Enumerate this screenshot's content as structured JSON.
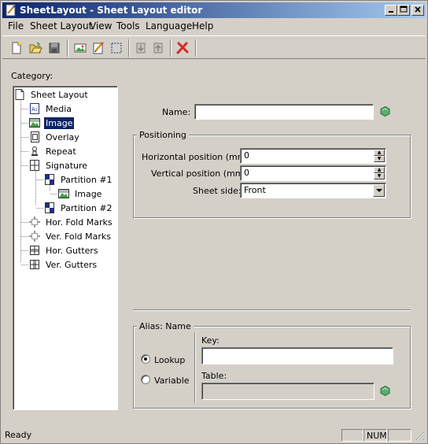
{
  "window": {
    "title": "SheetLayout - Sheet Layout editor",
    "minimize": "0",
    "maximize": "1",
    "close": "r"
  },
  "menu": [
    {
      "label": "File"
    },
    {
      "label": "Sheet Layout"
    },
    {
      "label": "View"
    },
    {
      "label": "Tools"
    },
    {
      "label": "Language"
    },
    {
      "label": "Help"
    }
  ],
  "toolbar": {
    "icons": [
      "new-document-icon",
      "open-icon",
      "save-icon",
      "image-icon",
      "edit-icon",
      "select-icon",
      "move-down-icon",
      "move-up-icon",
      "delete-icon"
    ]
  },
  "category": {
    "label": "Category:",
    "tree": [
      {
        "label": "Sheet Layout",
        "icon": "page-icon"
      },
      {
        "label": "Media",
        "icon": "media-icon"
      },
      {
        "label": "Image",
        "icon": "image-icon",
        "selected": true
      },
      {
        "label": "Overlay",
        "icon": "overlay-icon"
      },
      {
        "label": "Repeat",
        "icon": "repeat-icon"
      },
      {
        "label": "Signature",
        "icon": "signature-icon"
      },
      {
        "label": "Partition #1",
        "icon": "partition-icon"
      },
      {
        "label": "Image",
        "icon": "image-icon"
      },
      {
        "label": "Partition #2",
        "icon": "partition-icon"
      },
      {
        "label": "Hor. Fold Marks",
        "icon": "fold-marks-icon"
      },
      {
        "label": "Ver. Fold Marks",
        "icon": "fold-marks-icon"
      },
      {
        "label": "Hor. Gutters",
        "icon": "gutters-icon"
      },
      {
        "label": "Ver. Gutters",
        "icon": "gutters-icon"
      }
    ]
  },
  "form": {
    "name_label": "Name:",
    "name_value": "",
    "positioning": {
      "title": "Positioning",
      "horizontal_label": "Horizontal position (mm):",
      "horizontal_value": "0",
      "vertical_label": "Vertical position (mm):",
      "vertical_value": "0",
      "sheet_side_label": "Sheet side:",
      "sheet_side_value": "Front"
    },
    "alias": {
      "title": "Alias: Name",
      "lookup_label": "Lookup",
      "variable_label": "Variable",
      "selected": "Lookup",
      "key_label": "Key:",
      "key_value": "",
      "table_label": "Table:",
      "table_value": ""
    }
  },
  "status": {
    "text": "Ready",
    "num": "NUM"
  },
  "colors": {
    "face": "#d4d0c8",
    "title_start": "#0a246a",
    "title_end": "#a6caf0",
    "selection": "#0a246a",
    "hex_green": "#5cae6e",
    "delete_red": "#d8282a"
  }
}
